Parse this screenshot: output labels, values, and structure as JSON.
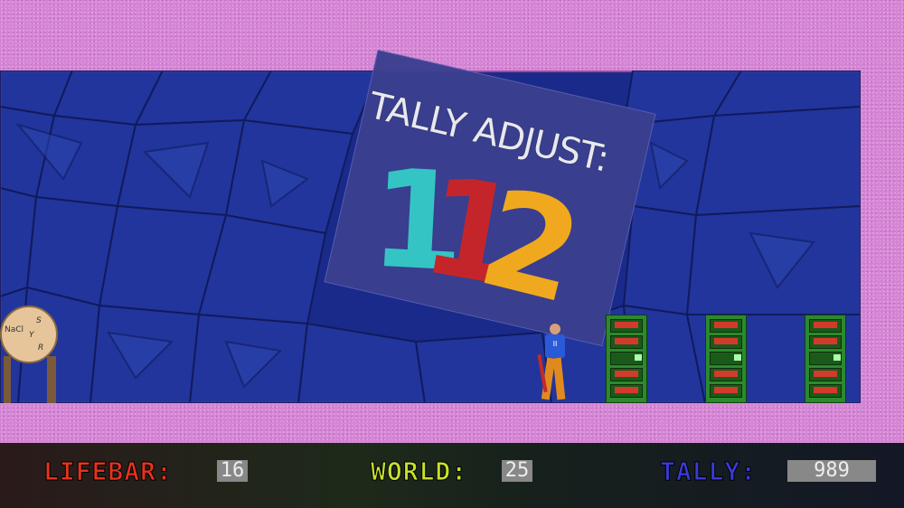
{
  "sign": {
    "title": "TALLY ADJUST:",
    "digits": [
      "1",
      "1",
      "2"
    ],
    "digit_colors": [
      "#35c4c4",
      "#c4252b",
      "#f0a91e"
    ]
  },
  "machine": {
    "labels": [
      "NaCl",
      "S",
      "Y",
      "R"
    ]
  },
  "player": {
    "shirt_label": "II"
  },
  "hud": {
    "lifebar_label": "LIFEBAR:",
    "lifebar_value": "16",
    "world_label": "WORLD:",
    "world_value": "25",
    "tally_label": "TALLY:",
    "tally_value": "989"
  },
  "colors": {
    "lifebar": "#e8321e",
    "world": "#c8e02a",
    "tally": "#3a3ad8",
    "wall": "#d685d6",
    "room": "#1a2a8a"
  }
}
